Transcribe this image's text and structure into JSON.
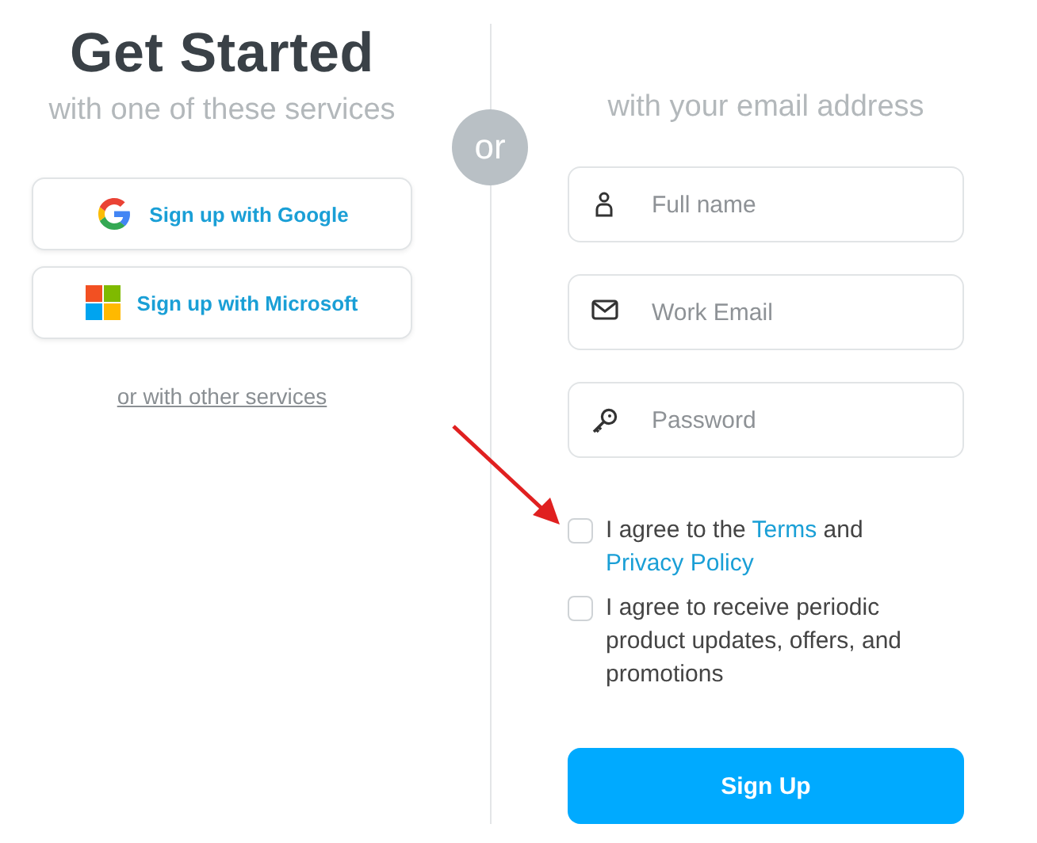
{
  "heading": {
    "title": "Get Started",
    "subtitle": "with one of these services"
  },
  "social_buttons": [
    {
      "kind": "google",
      "label": "Sign up with Google"
    },
    {
      "kind": "microsoft",
      "label": "Sign up with Microsoft"
    }
  ],
  "other_services_link": "or with other services",
  "divider_label": "or",
  "email_heading": "with your email address",
  "fields": [
    {
      "kind": "person",
      "placeholder": "Full name"
    },
    {
      "kind": "mail",
      "placeholder": "Work Email"
    },
    {
      "kind": "key",
      "placeholder": "Password"
    }
  ],
  "checkboxes": [
    {
      "checked": false,
      "parts": [
        {
          "kind": "text",
          "text": "I agree to the "
        },
        {
          "kind": "link",
          "text": "Terms"
        },
        {
          "kind": "text",
          "text": " and "
        },
        {
          "kind": "link",
          "text": "Privacy Policy"
        }
      ]
    },
    {
      "checked": false,
      "parts": [
        {
          "kind": "text",
          "text": "I agree to receive periodic product updates, offers, and promotions"
        }
      ]
    }
  ],
  "submit_button": "Sign Up"
}
